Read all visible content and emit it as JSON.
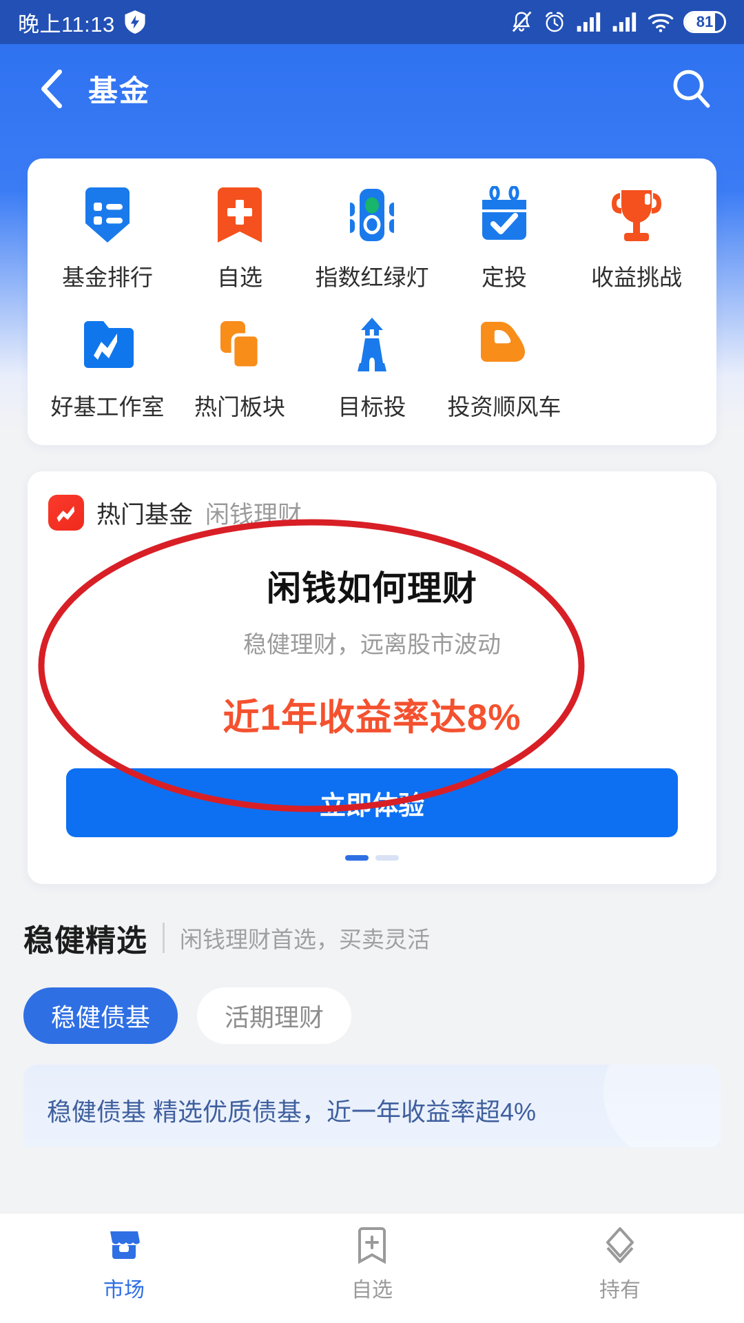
{
  "statusbar": {
    "time": "晚上11:13",
    "shield_icon": "shield-icon",
    "mute_icon": "bell-muted-icon",
    "alarm_icon": "alarm-clock-icon",
    "signal1_icon": "signal-bars-icon",
    "signal2_icon": "signal-bars-icon",
    "wifi_icon": "wifi-icon",
    "battery_level": "81",
    "bg_color": "#2250b5"
  },
  "navbar": {
    "back_icon": "back-chevron-icon",
    "title": "基金",
    "search_icon": "search-icon",
    "bg_color": "#2f72f0"
  },
  "shortcuts": {
    "row1": [
      {
        "label": "基金排行",
        "icon": "list-bookmark-icon",
        "color": "#1a7aec"
      },
      {
        "label": "自选",
        "icon": "plus-bookmark-icon",
        "color": "#f4511e"
      },
      {
        "label": "指数红绿灯",
        "icon": "traffic-light-icon",
        "color": "#1a7aec"
      },
      {
        "label": "定投",
        "icon": "calendar-check-icon",
        "color": "#1a7aec"
      },
      {
        "label": "收益挑战",
        "icon": "trophy-icon",
        "color": "#f4511e"
      }
    ],
    "row2": [
      {
        "label": "好基工作室",
        "icon": "folder-chart-icon",
        "color": "#1a7aec"
      },
      {
        "label": "热门板块",
        "icon": "stacked-squares-icon",
        "color": "#f88d1a"
      },
      {
        "label": "目标投",
        "icon": "lighthouse-icon",
        "color": "#1a7aec"
      },
      {
        "label": "投资顺风车",
        "icon": "car-icon",
        "color": "#f88d1a"
      }
    ]
  },
  "promo": {
    "logo_icon": "trend-up-logo-icon",
    "tab_active": "热门基金",
    "tab_inactive": "闲钱理财",
    "headline": "闲钱如何理财",
    "subtitle": "稳健理财，远离股市波动",
    "rate_text": "近1年收益率达8%",
    "rate_color": "#f4512f",
    "cta_label": "立即体验",
    "cta_color": "#0d70f2"
  },
  "section": {
    "title": "稳健精选",
    "subtitle": "闲钱理财首选，买卖灵活",
    "pills": [
      {
        "label": "稳健债基",
        "active": true
      },
      {
        "label": "活期理财",
        "active": false
      }
    ],
    "fund_card_text": "稳健债基  精选优质债基，近一年收益率超4%"
  },
  "tabbar": {
    "items": [
      {
        "label": "市场",
        "icon": "shop-icon",
        "active": true
      },
      {
        "label": "自选",
        "icon": "bookmark-plus-icon",
        "active": false
      },
      {
        "label": "持有",
        "icon": "layers-diamond-icon",
        "active": false
      }
    ],
    "active_color": "#2f6fe4"
  },
  "annotation": {
    "shape": "red-ellipse-highlight",
    "color": "#d81f26"
  }
}
